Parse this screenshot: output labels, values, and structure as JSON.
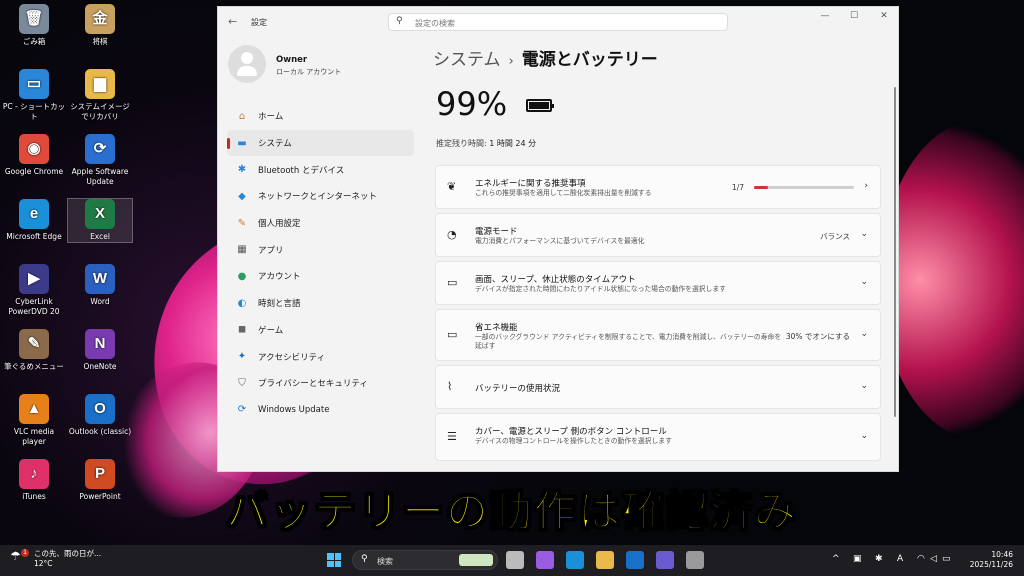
{
  "desktop": {
    "icons": [
      {
        "label": "ごみ箱",
        "icon": "recycle-bin-icon",
        "color": "#7a8a9a",
        "glyph": "🗑"
      },
      {
        "label": "将棋",
        "icon": "shogi-icon",
        "color": "#c8a060",
        "glyph": "金"
      },
      {
        "label": "PC - ショートカット",
        "icon": "pc-icon",
        "color": "#2a86d8",
        "glyph": "▭"
      },
      {
        "label": "システムイメージでリカバリ",
        "icon": "folder-icon",
        "color": "#e8b84a",
        "glyph": "▆"
      },
      {
        "label": "Google Chrome",
        "icon": "chrome-icon",
        "color": "#e04a3a",
        "glyph": "◉"
      },
      {
        "label": "Apple Software Update",
        "icon": "apple-update-icon",
        "color": "#2a6fd0",
        "glyph": "⟳"
      },
      {
        "label": "Microsoft Edge",
        "icon": "edge-icon",
        "color": "#1b8fd8",
        "glyph": "e"
      },
      {
        "label": "Excel",
        "icon": "excel-icon",
        "color": "#1f7a45",
        "glyph": "X"
      },
      {
        "label": "CyberLink PowerDVD 20",
        "icon": "powerdvd-icon",
        "color": "#3b3b8a",
        "glyph": "▶"
      },
      {
        "label": "Word",
        "icon": "word-icon",
        "color": "#2b5fc0",
        "glyph": "W"
      },
      {
        "label": "筆ぐるめメニュー",
        "icon": "fudegurume-icon",
        "color": "#8a6a4a",
        "glyph": "✎"
      },
      {
        "label": "OneNote",
        "icon": "onenote-icon",
        "color": "#7a3bb0",
        "glyph": "N"
      },
      {
        "label": "VLC media player",
        "icon": "vlc-icon",
        "color": "#e8801a",
        "glyph": "▲"
      },
      {
        "label": "Outlook (classic)",
        "icon": "outlook-icon",
        "color": "#1a6fc8",
        "glyph": "O"
      },
      {
        "label": "iTunes",
        "icon": "itunes-icon",
        "color": "#e0306a",
        "glyph": "♪"
      },
      {
        "label": "PowerPoint",
        "icon": "powerpoint-icon",
        "color": "#d04a22",
        "glyph": "P"
      }
    ]
  },
  "window": {
    "title": "設定",
    "search_placeholder": "設定の検索",
    "controls": {
      "minimize": "—",
      "maximize": "☐",
      "close": "✕"
    }
  },
  "profile": {
    "name": "Owner",
    "account": "ローカル アカウント"
  },
  "sidebar": {
    "items": [
      {
        "label": "ホーム",
        "icon": "home-icon",
        "glyph": "⌂",
        "color": "#c08040"
      },
      {
        "label": "システム",
        "icon": "system-icon",
        "glyph": "▬",
        "color": "#2a86d8"
      },
      {
        "label": "Bluetooth とデバイス",
        "icon": "bluetooth-icon",
        "glyph": "✱",
        "color": "#2a86d8"
      },
      {
        "label": "ネットワークとインターネット",
        "icon": "network-icon",
        "glyph": "◆",
        "color": "#2a86d8"
      },
      {
        "label": "個人用設定",
        "icon": "personalization-icon",
        "glyph": "✎",
        "color": "#d07a30"
      },
      {
        "label": "アプリ",
        "icon": "apps-icon",
        "glyph": "▦",
        "color": "#555"
      },
      {
        "label": "アカウント",
        "icon": "account-icon",
        "glyph": "●",
        "color": "#2aa060"
      },
      {
        "label": "時刻と言語",
        "icon": "time-language-icon",
        "glyph": "◐",
        "color": "#2a86d8"
      },
      {
        "label": "ゲーム",
        "icon": "gaming-icon",
        "glyph": "◼",
        "color": "#666"
      },
      {
        "label": "アクセシビリティ",
        "icon": "accessibility-icon",
        "glyph": "✦",
        "color": "#1a6fc8"
      },
      {
        "label": "プライバシーとセキュリティ",
        "icon": "shield-icon",
        "glyph": "⛉",
        "color": "#666"
      },
      {
        "label": "Windows Update",
        "icon": "windows-update-icon",
        "glyph": "⟳",
        "color": "#1a7ad8"
      }
    ],
    "active_index": 1
  },
  "main": {
    "breadcrumb_parent": "システム",
    "breadcrumb_sep": "›",
    "title": "電源とバッテリー",
    "battery_percent": "99%",
    "battery_level": 0.99,
    "remaining_label": "推定残り時間:",
    "remaining_value": "1 時間 24 分",
    "cards": [
      {
        "icon": "leaf-icon",
        "glyph": "❦",
        "title": "エネルギーに関する推奨事項",
        "subtitle": "これらの推奨事項を適用して二酸化炭素排出量を削減する",
        "value": "1/7",
        "progress": 0.14,
        "chevron": "›"
      },
      {
        "icon": "power-mode-icon",
        "glyph": "◔",
        "title": "電源モード",
        "subtitle": "電力消費とパフォーマンスに基づいてデバイスを最適化",
        "value": "バランス",
        "chevron": "⌄"
      },
      {
        "icon": "screen-sleep-icon",
        "glyph": "▭",
        "title": "画面、スリープ、休止状態のタイムアウト",
        "subtitle": "デバイスが指定された時間にわたりアイドル状態になった場合の動作を選択します",
        "value": "",
        "chevron": "⌄"
      },
      {
        "icon": "energy-saver-icon",
        "glyph": "▭",
        "title": "省エネ機能",
        "subtitle": "一部のバックグラウンド アクティビティを制限することで、電力消費を削減し、バッテリーの寿命を延ばす",
        "value": "30% でオンにする",
        "chevron": "⌄"
      },
      {
        "icon": "battery-usage-icon",
        "glyph": "⌇",
        "title": "バッテリーの使用状況",
        "subtitle": "",
        "value": "",
        "chevron": "⌄"
      },
      {
        "icon": "buttons-control-icon",
        "glyph": "☰",
        "title": "カバー、電源とスリープ 側のボタン コントロール",
        "subtitle": "デバイスの物理コントロールを操作したときの動作を選択します",
        "value": "",
        "chevron": "⌄"
      }
    ]
  },
  "caption": "バッテリーの動作は確認済み",
  "taskbar": {
    "weather_text": "この先、雨の日が...",
    "weather_temp": "12°C",
    "weather_badge": "1",
    "search_label": "検索",
    "apps": [
      {
        "icon": "task-view-icon",
        "color": "#bbbbbb"
      },
      {
        "icon": "copilot-icon",
        "color": "#9a5ce0"
      },
      {
        "icon": "edge-taskbar-icon",
        "color": "#1b8fd8"
      },
      {
        "icon": "file-explorer-icon",
        "color": "#e8b84a"
      },
      {
        "icon": "outlook-taskbar-icon",
        "color": "#1a6fc8"
      },
      {
        "icon": "teams-icon",
        "color": "#6a5cd0"
      },
      {
        "icon": "settings-taskbar-icon",
        "color": "#9a9a9a"
      }
    ],
    "tray": {
      "chevron": "^",
      "ime": "A",
      "time": "10:46",
      "date": "2025/11/26"
    }
  }
}
